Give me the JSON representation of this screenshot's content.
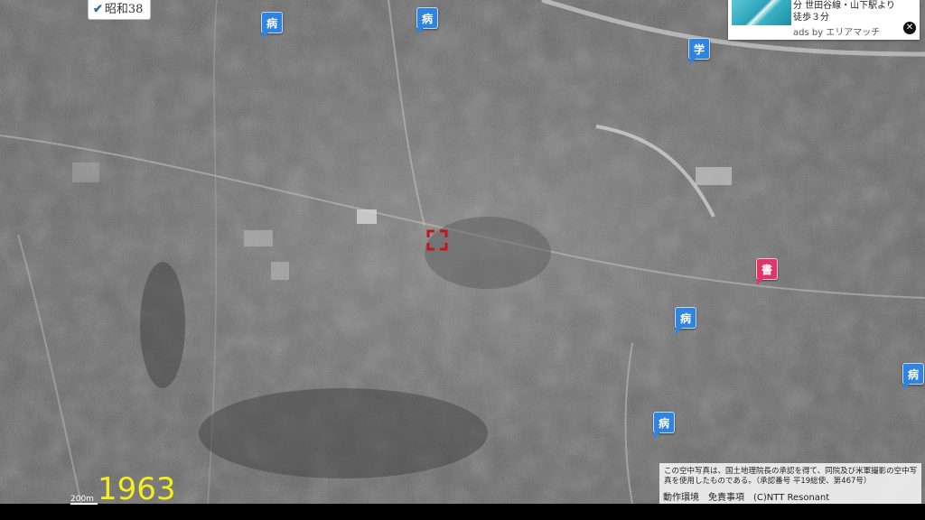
{
  "era": {
    "check_icon": "checkmark",
    "label": "昭和38"
  },
  "year_label": "1963",
  "scale_label": "200m",
  "pins": [
    {
      "type": "hospital",
      "glyph": "病",
      "color": "#2f84e0"
    },
    {
      "type": "hospital",
      "glyph": "病",
      "color": "#2f84e0"
    },
    {
      "type": "school",
      "glyph": "学",
      "color": "#2f84e0"
    },
    {
      "type": "library",
      "glyph": "書",
      "color": "#e0356a"
    },
    {
      "type": "hospital",
      "glyph": "病",
      "color": "#2f84e0"
    },
    {
      "type": "hospital",
      "glyph": "病",
      "color": "#2f84e0"
    },
    {
      "type": "hospital",
      "glyph": "病",
      "color": "#2f84e0"
    }
  ],
  "ad": {
    "text": "分 世田谷線・山下駅より徒歩３分",
    "source": "ads by エリアマッチ",
    "close_icon": "close"
  },
  "credit": {
    "notice": "この空中写真は、国土地理院長の承認を得て、同院及び米軍撮影の空中写真を使用したものである。（承認番号 平19総使、第467号）",
    "links": [
      "動作環境",
      "免責事項",
      "(C)NTT Resonant"
    ]
  }
}
